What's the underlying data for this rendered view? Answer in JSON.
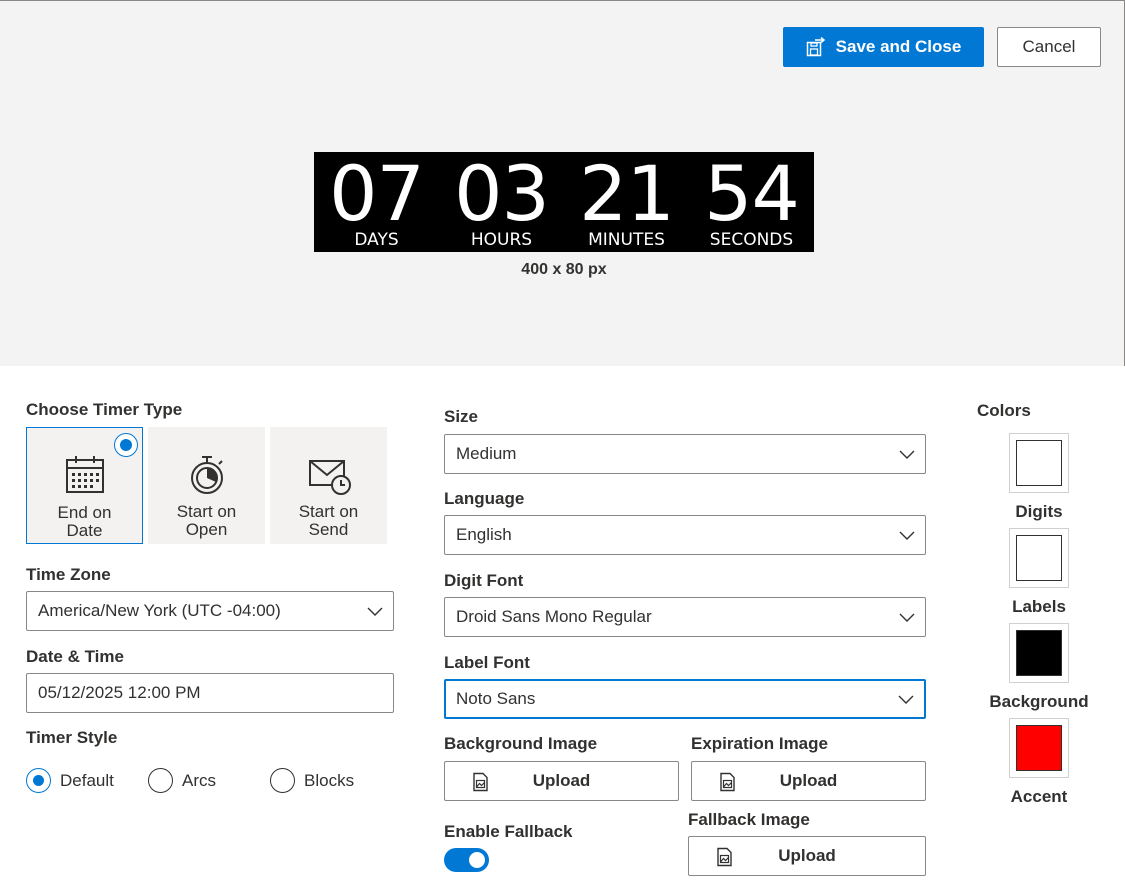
{
  "header": {
    "save_label": "Save and Close",
    "cancel_label": "Cancel"
  },
  "preview": {
    "units": [
      {
        "value": "07",
        "label": "DAYS"
      },
      {
        "value": "03",
        "label": "HOURS"
      },
      {
        "value": "21",
        "label": "MINUTES"
      },
      {
        "value": "54",
        "label": "SECONDS"
      }
    ],
    "dimensions": "400 x 80 px"
  },
  "timer_type": {
    "heading": "Choose Timer Type",
    "options": [
      {
        "line1": "End on",
        "line2": "Date",
        "selected": true,
        "icon": "calendar-icon"
      },
      {
        "line1": "Start on",
        "line2": "Open",
        "selected": false,
        "icon": "stopwatch-icon"
      },
      {
        "line1": "Start on",
        "line2": "Send",
        "selected": false,
        "icon": "envelope-clock-icon"
      }
    ]
  },
  "time_zone": {
    "label": "Time Zone",
    "value": "America/New York (UTC -04:00)"
  },
  "date_time": {
    "label": "Date & Time",
    "value": "05/12/2025 12:00 PM"
  },
  "timer_style": {
    "label": "Timer Style",
    "options": [
      {
        "label": "Default",
        "selected": true
      },
      {
        "label": "Arcs",
        "selected": false
      },
      {
        "label": "Blocks",
        "selected": false
      }
    ]
  },
  "size": {
    "label": "Size",
    "value": "Medium"
  },
  "language": {
    "label": "Language",
    "value": "English"
  },
  "digit_font": {
    "label": "Digit Font",
    "value": "Droid Sans Mono Regular"
  },
  "label_font": {
    "label": "Label Font",
    "value": "Noto Sans"
  },
  "background_image": {
    "label": "Background Image",
    "button": "Upload"
  },
  "expiration_image": {
    "label": "Expiration Image",
    "button": "Upload"
  },
  "fallback": {
    "label": "Enable Fallback",
    "enabled": true
  },
  "fallback_image": {
    "label": "Fallback Image",
    "button": "Upload"
  },
  "colors": {
    "heading": "Colors",
    "items": [
      {
        "label": "Digits",
        "color": "#ffffff"
      },
      {
        "label": "Labels",
        "color": "#ffffff"
      },
      {
        "label": "Background",
        "color": "#000000"
      },
      {
        "label": "Accent",
        "color": "#ff0000"
      }
    ]
  },
  "theme": {
    "accent": "#0078d4"
  }
}
